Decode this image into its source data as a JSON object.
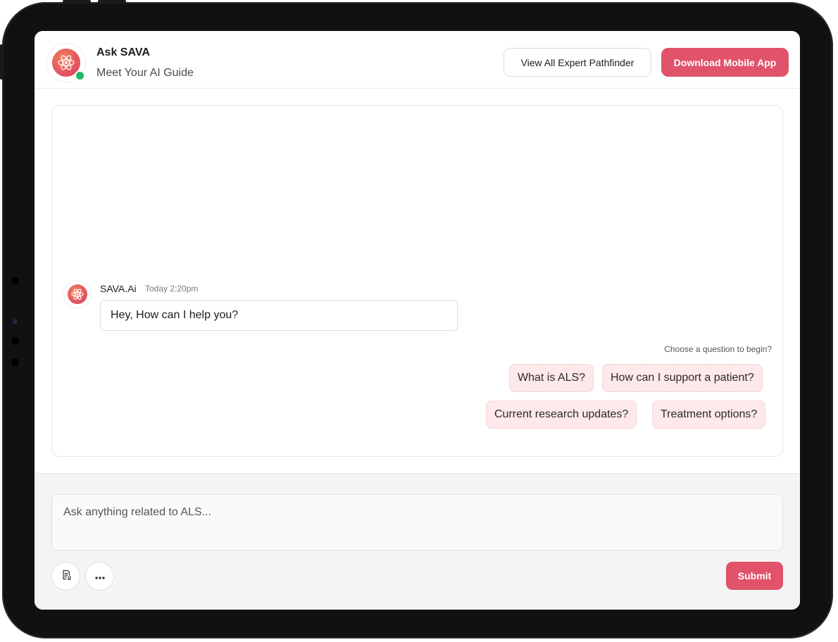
{
  "header": {
    "title": "Ask SAVA",
    "subtitle": "Meet Your AI Guide",
    "view_all_label": "View All Expert Pathfinder",
    "download_label": "Download Mobile App"
  },
  "chat": {
    "messages": [
      {
        "sender": "SAVA.Ai",
        "time": "Today 2:20pm",
        "text": "Hey, How can I help you?"
      }
    ],
    "prompt_hint": "Choose a question to begin?",
    "suggestions": [
      "What is ALS?",
      "How can I support a patient?",
      "Current research updates?",
      "Treatment options?"
    ]
  },
  "composer": {
    "placeholder": "Ask anything related to ALS...",
    "submit_label": "Submit",
    "attach_icon": "document-attach-icon",
    "more_icon": "more-horizontal-icon"
  },
  "colors": {
    "accent": "#e0536a",
    "chip_bg": "#fde8ea",
    "online": "#1fb866"
  }
}
